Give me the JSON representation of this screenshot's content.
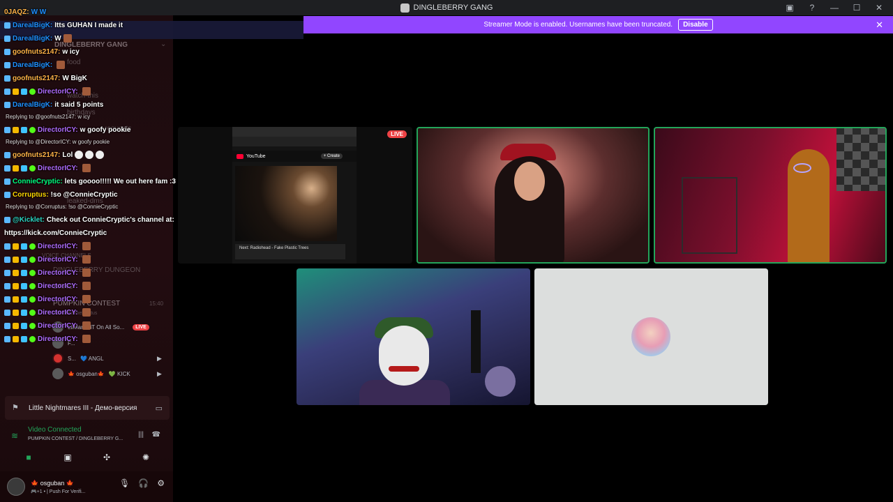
{
  "titlebar": {
    "title": "DINGLEBERRY GANG",
    "actions": [
      "inbox-icon",
      "help-icon",
      "minimize-icon",
      "maximize-icon",
      "close-icon"
    ]
  },
  "banner": {
    "text": "Streamer Mode is enabled. Usernames have been truncated.",
    "button": "Disable",
    "close": "✕"
  },
  "sidebar": {
    "ghost_items": {
      "server": "DINGLEBERRY GANG",
      "food": "food",
      "watch": "watch-this",
      "birthdays": "birthdays",
      "requests": "requests",
      "leaked": "leaked-dms",
      "voice_channels": "VOICE CHANNELS",
      "dungeon": "DINGLEBERRY DUNGEON",
      "drag": "DRAG",
      "contest": "PUMPKIN CONTEST",
      "contest_time": "15:40",
      "set_status": "Set a channel status"
    },
    "voice_users": [
      {
        "name": "LilMammiT On All So...",
        "live": "LIVE"
      },
      {
        "name": "F..."
      },
      {
        "name": "S...",
        "suffix": "💙 ANGL"
      },
      {
        "name": "🍁 osguban🍁",
        "suffix": "💚 KICK"
      }
    ]
  },
  "activity": {
    "game": "Little Nightmares III - Демо-версия"
  },
  "voice": {
    "status": "Video Connected",
    "channel": "PUMPKIN CONTEST / DINGLEBERRY G..."
  },
  "user": {
    "name": "🍁 osguban 🍁",
    "status": "🎮+1 • | Push For Verifi..."
  },
  "chat": {
    "header_user": "0JAQZ:",
    "header_msg": "W W",
    "lines": [
      {
        "user": "DarealBigK:",
        "msg": "Itts GUHAN I made it",
        "color": "blue"
      },
      {
        "user": "DarealBigK:",
        "msg": "W",
        "color": "blue"
      },
      {
        "user": "goofnuts2147:",
        "msg": "w icy",
        "color": "orange"
      },
      {
        "user": "DarealBigK:",
        "msg": "",
        "color": "blue"
      },
      {
        "user": "goofnuts2147:",
        "msg": "W BigK",
        "color": "orange"
      },
      {
        "user": "DirectorICY:",
        "msg": "",
        "color": "purple"
      },
      {
        "user": "DarealBigK:",
        "msg": "it said 5 points",
        "color": "blue"
      },
      {
        "reply": "Replying to @goofnuts2147: w icy"
      },
      {
        "user": "DirectorICY:",
        "msg": "w goofy pookie",
        "color": "purple"
      },
      {
        "reply": "Replying to @DirectorICY: w goofy pookie"
      },
      {
        "user": "goofnuts2147:",
        "msg": "Lol",
        "color": "orange"
      },
      {
        "user": "DirectorICY:",
        "msg": "",
        "color": "purple"
      },
      {
        "user": "ConnieCryptic:",
        "msg": "lets goooo!!!!! We out here fam :3",
        "color": "green"
      },
      {
        "user": "Corruptus:",
        "msg": "!so @ConnieCryptic",
        "color": "gold"
      },
      {
        "reply": "Replying to @Corruptus: !so @ConnieCryptic"
      },
      {
        "user": "@Kicklet:",
        "msg": "Check out ConnieCryptic's channel at:",
        "color": "teal"
      },
      {
        "cont": "https://kick.com/ConnieCryptic"
      },
      {
        "user": "DirectorICY:",
        "msg": "",
        "color": "purple"
      },
      {
        "user": "DirectorICY:",
        "msg": "",
        "color": "purple"
      },
      {
        "user": "DirectorICY:",
        "msg": "",
        "color": "purple"
      },
      {
        "user": "DirectorICY:",
        "msg": "",
        "color": "purple"
      },
      {
        "user": "DirectorICY:",
        "msg": "",
        "color": "purple"
      },
      {
        "user": "DirectorICY:",
        "msg": "",
        "color": "purple"
      },
      {
        "user": "DirectorICY:",
        "msg": "",
        "color": "purple"
      },
      {
        "user": "DirectorICY:",
        "msg": "",
        "color": "purple"
      }
    ]
  },
  "stage": {
    "screen_live": "LIVE",
    "browser_brand": "YouTube",
    "browser_create": "+ Create",
    "next_up": "Next: Radiohead - Fake Plastic Trees"
  },
  "colors": {
    "banner": "#9146ff",
    "speaking_border": "#23a55a",
    "live_red": "#ed4245"
  }
}
